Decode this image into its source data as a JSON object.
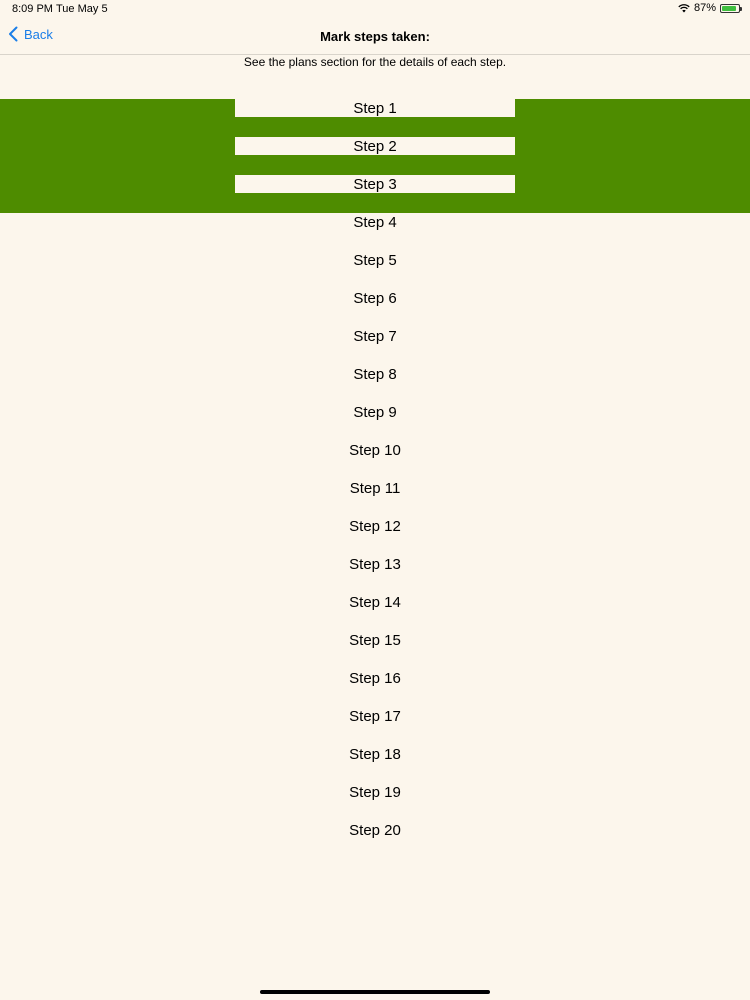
{
  "status": {
    "time": "8:09 PM",
    "date": "Tue May 5",
    "battery": "87%",
    "battery_level": 0.87
  },
  "nav": {
    "back_label": "Back",
    "title": "Mark steps taken:"
  },
  "subtitle": "See the plans section for the details of each step.",
  "colors": {
    "selected_band": "#4e8c00",
    "background": "#fcf6ec",
    "accent": "#1a7ee8"
  },
  "steps": [
    {
      "label": "Step 1",
      "selected": true
    },
    {
      "label": "Step 2",
      "selected": true
    },
    {
      "label": "Step 3",
      "selected": true
    },
    {
      "label": "Step 4",
      "selected": false
    },
    {
      "label": "Step 5",
      "selected": false
    },
    {
      "label": "Step 6",
      "selected": false
    },
    {
      "label": "Step 7",
      "selected": false
    },
    {
      "label": "Step 8",
      "selected": false
    },
    {
      "label": "Step 9",
      "selected": false
    },
    {
      "label": "Step 10",
      "selected": false
    },
    {
      "label": "Step 11",
      "selected": false
    },
    {
      "label": "Step 12",
      "selected": false
    },
    {
      "label": "Step 13",
      "selected": false
    },
    {
      "label": "Step 14",
      "selected": false
    },
    {
      "label": "Step 15",
      "selected": false
    },
    {
      "label": "Step 16",
      "selected": false
    },
    {
      "label": "Step 17",
      "selected": false
    },
    {
      "label": "Step 18",
      "selected": false
    },
    {
      "label": "Step 19",
      "selected": false
    },
    {
      "label": "Step 20",
      "selected": false
    }
  ]
}
